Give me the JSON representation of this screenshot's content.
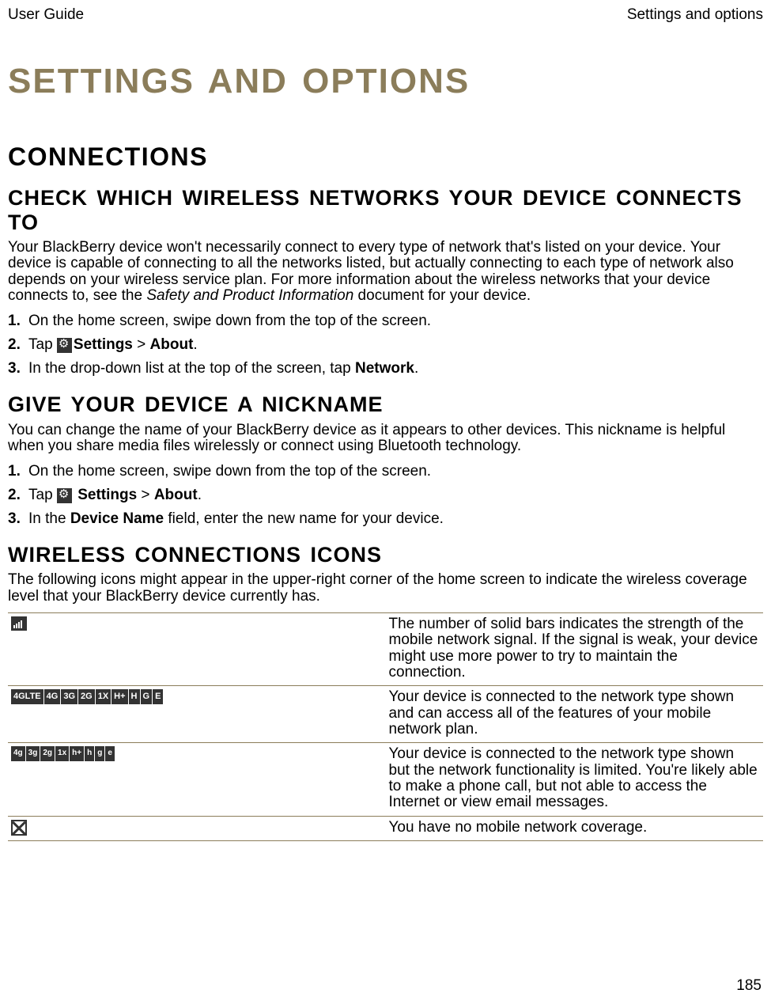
{
  "header": {
    "left": "User Guide",
    "right": "Settings and options"
  },
  "chapter_title": "SETTINGS AND OPTIONS",
  "connections": {
    "title": "CONNECTIONS",
    "check_networks": {
      "title": "CHECK WHICH WIRELESS NETWORKS YOUR DEVICE CONNECTS TO",
      "intro_pre": "Your BlackBerry device won't necessarily connect to every type of network that's listed on your device. Your device is capable of connecting to all the networks listed, but actually connecting to each type of network also depends on your wireless service plan. For more information about the wireless networks that your device connects to, see the ",
      "intro_italic": "Safety and Product Information",
      "intro_post": " document for your device.",
      "steps": {
        "s1": "On the home screen, swipe down from the top of the screen.",
        "s2_pre": "Tap ",
        "s2_settings": "Settings",
        "s2_gt": " > ",
        "s2_about": "About",
        "s2_end": ".",
        "s3_pre": "In the drop-down list at the top of the screen, tap ",
        "s3_bold": "Network",
        "s3_end": "."
      }
    },
    "nickname": {
      "title": "GIVE YOUR DEVICE A NICKNAME",
      "intro": "You can change the name of your BlackBerry device as it appears to other devices. This nickname is helpful when you share media files wirelessly or connect using Bluetooth technology.",
      "steps": {
        "s1": "On the home screen, swipe down from the top of the screen.",
        "s2_pre": "Tap ",
        "s2_settings": " Settings",
        "s2_gt": " > ",
        "s2_about": "About",
        "s2_end": ".",
        "s3_pre": "In the ",
        "s3_bold": "Device Name",
        "s3_post": " field, enter the new name for your device."
      }
    },
    "icons": {
      "title": "WIRELESS CONNECTIONS ICONS",
      "intro": "The following icons might appear in the upper-right corner of the home screen to indicate the wireless coverage level that your BlackBerry device currently has.",
      "rows": {
        "r1": "The number of solid bars indicates the strength of the mobile network signal. If the signal is weak, your device might use more power to try to maintain the connection.",
        "r2": "Your device is connected to the network type shown and can access all of the features of your mobile network plan.",
        "r3": "Your device is connected to the network type shown but the network functionality is limited. You're likely able to make a phone call, but not able to access the Internet or view email messages.",
        "r4": "You have no mobile network coverage."
      },
      "net_upper": {
        "a": "4GLTE",
        "b": "4G",
        "c": "3G",
        "d": "2G",
        "e": "1X",
        "f": "H+",
        "g": "H",
        "h": "G",
        "i": "E"
      },
      "net_lower": {
        "a": "4g",
        "b": "3g",
        "c": "2g",
        "d": "1x",
        "e": "h+",
        "f": "h",
        "g": "g",
        "h": "e"
      }
    }
  },
  "page_number": "185"
}
